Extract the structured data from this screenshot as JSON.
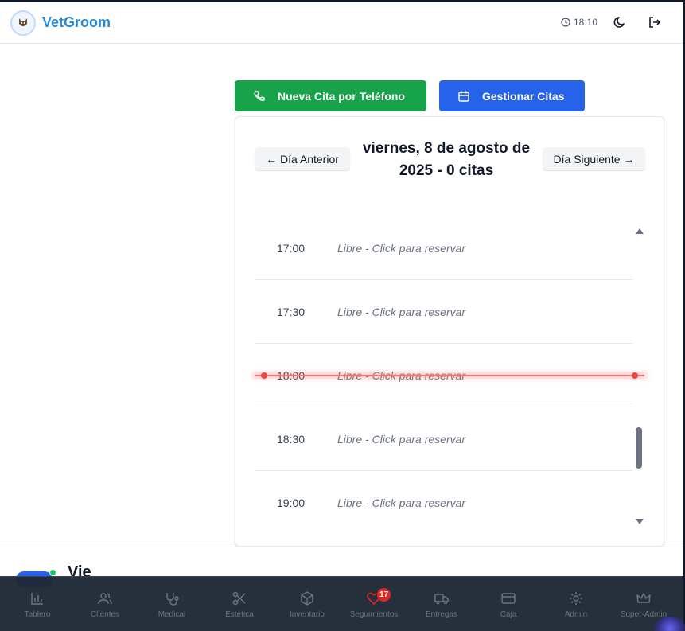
{
  "header": {
    "brand": "VetGroom",
    "time": "18:10"
  },
  "actions": {
    "new_phone_appointment": "Nueva Cita por Teléfono",
    "manage_appointments": "Gestionar Citas"
  },
  "calendar": {
    "prev_day": "← Día Anterior",
    "next_day": "Día Siguiente →",
    "title_line1": "viernes, 8 de agosto de",
    "title_line2": "2025 - 0 citas",
    "slots": [
      {
        "time": "17:00",
        "label": "Libre - Click para reservar"
      },
      {
        "time": "17:30",
        "label": "Libre - Click para reservar"
      },
      {
        "time": "18:00",
        "label": "Libre - Click para reservar"
      },
      {
        "time": "18:30",
        "label": "Libre - Click para reservar"
      },
      {
        "time": "19:00",
        "label": "Libre - Click para reservar"
      }
    ],
    "current_time_slot": "18:00"
  },
  "lower_section": {
    "heading_partial": "Vie"
  },
  "bottom_nav": {
    "items": [
      {
        "label": "Tablero",
        "icon": "bar-chart-icon"
      },
      {
        "label": "Clientes",
        "icon": "users-icon"
      },
      {
        "label": "Medical",
        "icon": "stethoscope-icon"
      },
      {
        "label": "Estética",
        "icon": "scissors-icon"
      },
      {
        "label": "Inventario",
        "icon": "package-icon"
      },
      {
        "label": "Seguimientos",
        "icon": "heart-icon",
        "badge": "17"
      },
      {
        "label": "Entregas",
        "icon": "truck-icon"
      },
      {
        "label": "Caja",
        "icon": "credit-card-icon"
      },
      {
        "label": "Admin",
        "icon": "gear-icon"
      },
      {
        "label": "Super-Admin",
        "icon": "crown-icon"
      }
    ]
  },
  "colors": {
    "brand": "#2589d8",
    "green_button": "#16a34a",
    "blue_button": "#2563eb",
    "now_indicator": "#ef4444",
    "badge": "#dc2626"
  }
}
